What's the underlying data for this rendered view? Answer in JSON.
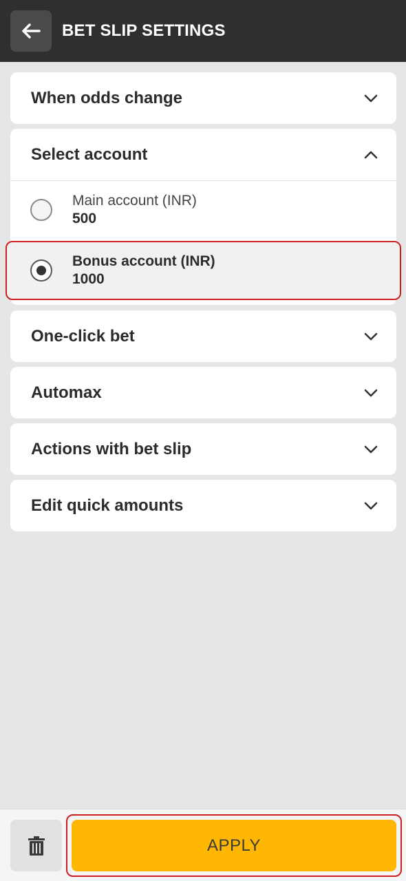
{
  "header": {
    "title": "BET SLIP SETTINGS",
    "back_icon": "arrow-left-icon"
  },
  "sections": {
    "odds_change": {
      "title": "When odds change",
      "expanded": false
    },
    "select_account": {
      "title": "Select account",
      "expanded": true,
      "options": [
        {
          "label": "Main account (INR)",
          "value": "500",
          "selected": false
        },
        {
          "label": "Bonus account (INR)",
          "value": "1000",
          "selected": true
        }
      ]
    },
    "one_click_bet": {
      "title": "One-click bet",
      "expanded": false
    },
    "automax": {
      "title": "Automax",
      "expanded": false
    },
    "actions": {
      "title": "Actions with bet slip",
      "expanded": false
    },
    "quick_amounts": {
      "title": "Edit quick amounts",
      "expanded": false
    }
  },
  "footer": {
    "delete_icon": "trash-icon",
    "apply_label": "APPLY"
  },
  "colors": {
    "header_bg": "#2f2f2f",
    "accent": "#ffb703",
    "highlight_border": "#cc1f24",
    "page_bg": "#e6e6e6"
  }
}
